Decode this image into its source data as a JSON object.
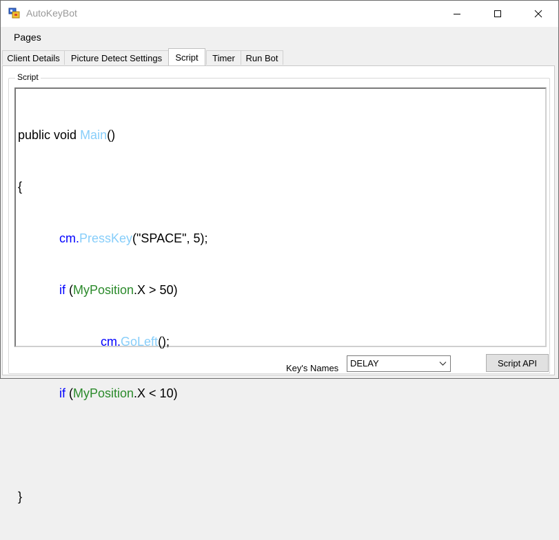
{
  "window": {
    "title": "AutoKeyBot"
  },
  "menu": {
    "pages": "Pages"
  },
  "tabs": [
    {
      "label": "Client Details"
    },
    {
      "label": "Picture Detect Settings"
    },
    {
      "label": "Script",
      "active": true
    },
    {
      "label": "Timer"
    },
    {
      "label": "Run Bot"
    }
  ],
  "script_group": {
    "label": "Script"
  },
  "code": {
    "line1": {
      "a": "public void ",
      "fn": "Main",
      "b": "()"
    },
    "line2": "{",
    "line3": {
      "obj": "cm",
      "dot": ".",
      "fn": "PressKey",
      "rest": "(\"SPACE\", 5);"
    },
    "line4": {
      "kw": "if",
      "p1": " (",
      "ty": "MyPosition",
      "rest": ".X > 50)"
    },
    "line5": {
      "obj": "cm",
      "dot": ".",
      "fn": "GoLeft",
      "rest": "();"
    },
    "line6": {
      "kw": "if",
      "p1": " (",
      "ty": "MyPosition",
      "rest": ".X < 10)"
    },
    "line8": "}"
  },
  "bottom": {
    "keys_label": "Key's Names",
    "keys_value": "DELAY",
    "script_api": "Script API"
  },
  "colors": {
    "keyword": "#0000ff",
    "type": "#2b8a2b",
    "method": "#87cefa"
  }
}
